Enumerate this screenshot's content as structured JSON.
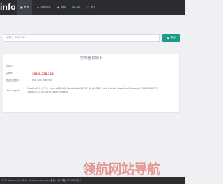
{
  "header": {
    "brand": "info",
    "nav": [
      {
        "label": "首页",
        "icon": "▣",
        "active": true
      },
      {
        "label": "功能列表",
        "icon": "≡",
        "active": false
      },
      {
        "label": "网络",
        "icon": "◆",
        "active": false
      },
      {
        "label": "API",
        "icon": "✉",
        "active": false
      },
      {
        "label": "关于",
        "icon": "ⓘ",
        "active": false
      }
    ]
  },
  "search": {
    "placeholder": "请输入 IP 或 URL",
    "button_label": "查询",
    "button_icon": "search-icon"
  },
  "panel": {
    "title": "您的信息如下",
    "rows": [
      {
        "label": "内网IP",
        "value": ""
      },
      {
        "label": "公网IP",
        "value": "202.8.228.214"
      },
      {
        "label": "地区/运营商",
        "value": "null null null null"
      },
      {
        "label": "User Agent",
        "value": "Mozilla/5.0 (X11; Linux x86_64) AppleWebKit/537.36 (KHTML, like Gecko) HeadlessChrome/120.0.6099.216 Safari/537.36 AcFun.com AcBaike"
      }
    ]
  },
  "footer": {
    "text": "2024 Powered by iPinfo · Author: xiaoz.me | 备案：京ICP备20244890号-1"
  },
  "watermark": {
    "text": "领航网站导航"
  },
  "colors": {
    "header_bg": "#2b2d31",
    "accent": "#1f9a86",
    "ip_highlight": "#e0403a",
    "page_bg": "#eef0f3"
  }
}
